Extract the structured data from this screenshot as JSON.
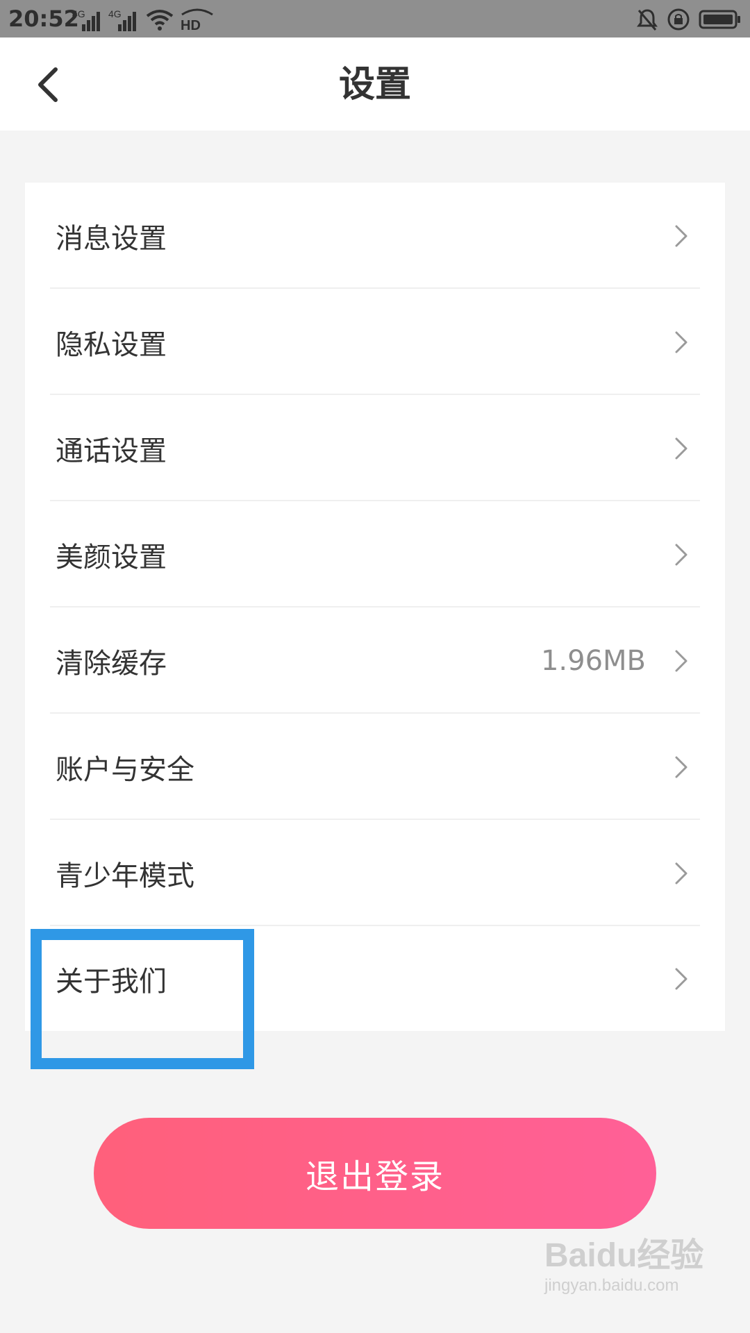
{
  "status_bar": {
    "time": "20:52",
    "left_icons": [
      "4g-signal-icon",
      "4g-signal-icon",
      "wifi-icon",
      "hd-icon"
    ],
    "right_icons": [
      "bell-off-icon",
      "rotation-lock-icon",
      "battery-icon"
    ],
    "network_labels": [
      "4G",
      "4G"
    ],
    "hd_label": "HD"
  },
  "header": {
    "title": "设置",
    "back_icon": "chevron-left-icon"
  },
  "settings": {
    "items": [
      {
        "label": "消息设置",
        "value": ""
      },
      {
        "label": "隐私设置",
        "value": ""
      },
      {
        "label": "通话设置",
        "value": ""
      },
      {
        "label": "美颜设置",
        "value": ""
      },
      {
        "label": "清除缓存",
        "value": "1.96MB"
      },
      {
        "label": "账户与安全",
        "value": ""
      },
      {
        "label": "青少年模式",
        "value": ""
      },
      {
        "label": "关于我们",
        "value": ""
      }
    ]
  },
  "logout": {
    "label": "退出登录"
  },
  "colors": {
    "accent_gradient_start": "#ff607b",
    "accent_gradient_end": "#ff6097",
    "highlight_box": "#2f98e6"
  },
  "watermark": {
    "main": "Baidu经验",
    "sub": "jingyan.baidu.com"
  }
}
